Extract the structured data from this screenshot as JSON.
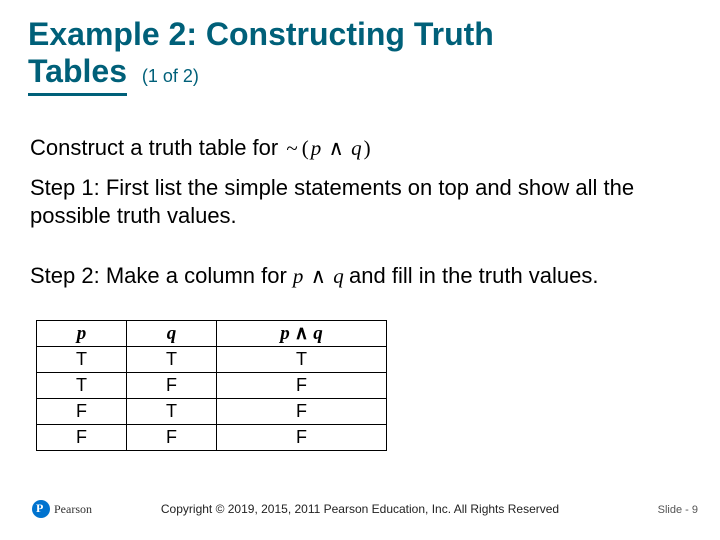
{
  "title": {
    "main_first": "Example 2: Constructing Truth",
    "main_last_word": "Tables",
    "sub": "(1 of 2)"
  },
  "body": {
    "line1_prefix": "Construct a truth table for ",
    "expr1_tilde": "~",
    "expr1_open": "(",
    "expr1_p": "p",
    "expr1_wedge": "∧",
    "expr1_q": "q",
    "expr1_close": ")",
    "step1": "Step 1: First list the simple statements on top and show all the possible truth values.",
    "step2_prefix": "Step 2: Make a column for ",
    "expr2_p": "p",
    "expr2_wedge": "∧",
    "expr2_q": "q",
    "step2_suffix": " and fill in the truth values."
  },
  "chart_data": {
    "type": "table",
    "columns": [
      "p",
      "q",
      "p ∧ q"
    ],
    "rows": [
      [
        "T",
        "T",
        "T"
      ],
      [
        "T",
        "F",
        "F"
      ],
      [
        "F",
        "T",
        "F"
      ],
      [
        "F",
        "F",
        "F"
      ]
    ],
    "header_p": "p",
    "header_q": "q",
    "header_pq_p": "p",
    "header_pq_wedge": "∧",
    "header_pq_q": "q"
  },
  "footer": {
    "brand": "Pearson",
    "copyright": "Copyright © 2019, 2015, 2011 Pearson Education, Inc. All Rights Reserved",
    "slide_label": "Slide - 9"
  }
}
